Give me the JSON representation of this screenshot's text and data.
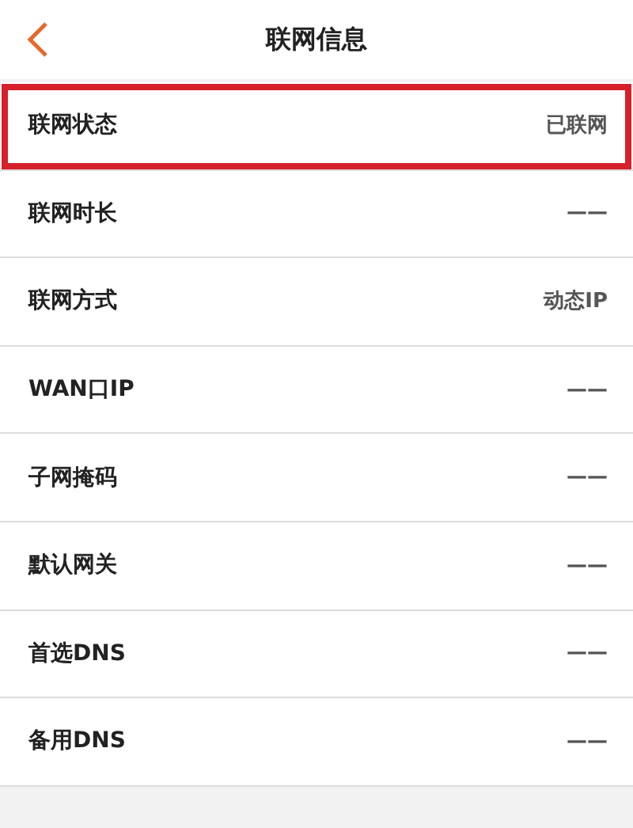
{
  "header": {
    "title": "联网信息"
  },
  "rows": [
    {
      "label": "联网状态",
      "value": "已联网",
      "highlighted": true
    },
    {
      "label": "联网时长",
      "value": "——",
      "highlighted": false
    },
    {
      "label": "联网方式",
      "value": "动态IP",
      "highlighted": false
    },
    {
      "label": "WAN口IP",
      "value": "——",
      "highlighted": false
    },
    {
      "label": "子网掩码",
      "value": "——",
      "highlighted": false
    },
    {
      "label": "默认网关",
      "value": "——",
      "highlighted": false
    },
    {
      "label": "首选DNS",
      "value": "——",
      "highlighted": false
    },
    {
      "label": "备用DNS",
      "value": "——",
      "highlighted": false
    }
  ]
}
